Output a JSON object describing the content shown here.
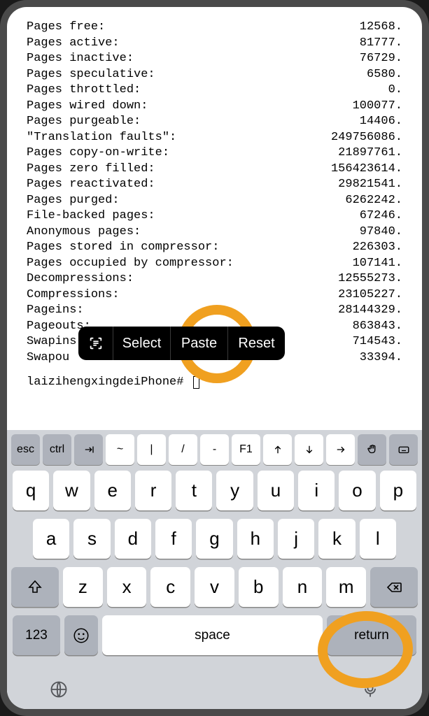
{
  "terminal": {
    "rows": [
      {
        "label": "Pages free:",
        "val": "12568."
      },
      {
        "label": "Pages active:",
        "val": "81777."
      },
      {
        "label": "Pages inactive:",
        "val": "76729."
      },
      {
        "label": "Pages speculative:",
        "val": "6580."
      },
      {
        "label": "Pages throttled:",
        "val": "0."
      },
      {
        "label": "Pages wired down:",
        "val": "100077."
      },
      {
        "label": "Pages purgeable:",
        "val": "14406."
      },
      {
        "label": "\"Translation faults\":",
        "val": "249756086."
      },
      {
        "label": "Pages copy-on-write:",
        "val": "21897761."
      },
      {
        "label": "Pages zero filled:",
        "val": "156423614."
      },
      {
        "label": "Pages reactivated:",
        "val": "29821541."
      },
      {
        "label": "Pages purged:",
        "val": "6262242."
      },
      {
        "label": "File-backed pages:",
        "val": "67246."
      },
      {
        "label": "Anonymous pages:",
        "val": "97840."
      },
      {
        "label": "Pages stored in compressor:",
        "val": "226303."
      },
      {
        "label": "Pages occupied by compressor:",
        "val": "107141."
      },
      {
        "label": "Decompressions:",
        "val": "12555273."
      },
      {
        "label": "Compressions:",
        "val": "23105227."
      },
      {
        "label": "Pageins:",
        "val": "28144329."
      },
      {
        "label": "Pageouts:",
        "val": "863843."
      },
      {
        "label": "Swapins:",
        "val": "714543."
      },
      {
        "label": "Swapou",
        "val": "33394."
      }
    ],
    "prompt": "laizihengxingdeiPhone#"
  },
  "context_menu": {
    "select": "Select",
    "paste": "Paste",
    "reset": "Reset"
  },
  "keyboard": {
    "fn": {
      "esc": "esc",
      "ctrl": "ctrl",
      "tilde": "~",
      "pipe": "|",
      "slash": "/",
      "dash": "-",
      "f1": "F1"
    },
    "row1": [
      "q",
      "w",
      "e",
      "r",
      "t",
      "y",
      "u",
      "i",
      "o",
      "p"
    ],
    "row2": [
      "a",
      "s",
      "d",
      "f",
      "g",
      "h",
      "j",
      "k",
      "l"
    ],
    "row3": [
      "z",
      "x",
      "c",
      "v",
      "b",
      "n",
      "m"
    ],
    "num": "123",
    "space": "space",
    "return": "return"
  }
}
